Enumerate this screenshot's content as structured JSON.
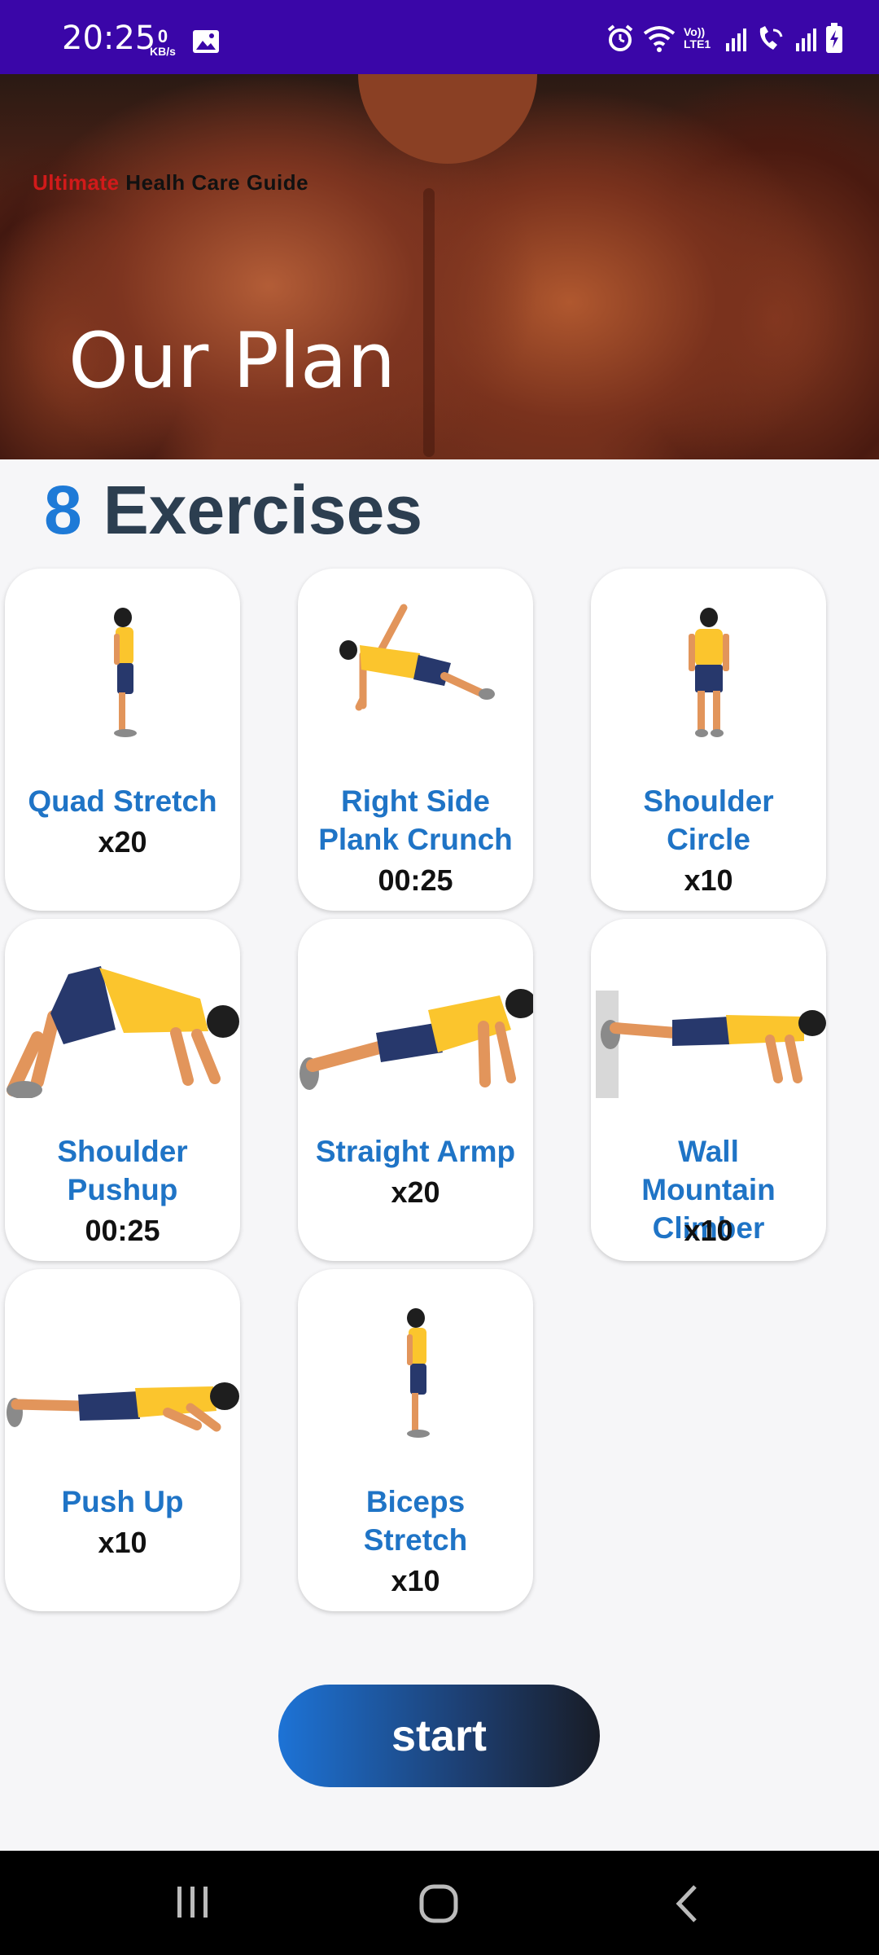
{
  "status_bar": {
    "time": "20:25",
    "network_speed_value": "0",
    "network_speed_unit": "KB/s",
    "volte_label": "Vo)) LTE1"
  },
  "header": {
    "brand_red": "Ultimate",
    "brand_rest": " Healh Care Guide",
    "title": "Our Plan"
  },
  "exercise_summary": {
    "count": "8",
    "label": "Exercises"
  },
  "exercises": [
    {
      "name": "Quad Stretch",
      "reps": "x20",
      "pose": "standing-side"
    },
    {
      "name": "Right Side Plank Crunch",
      "reps": "00:25",
      "pose": "side-plank"
    },
    {
      "name": "Shoulder Circle",
      "reps": "x10",
      "pose": "standing-front"
    },
    {
      "name": "Shoulder Pushup",
      "reps": "00:25",
      "pose": "pike-pushup"
    },
    {
      "name": "Straight Armp",
      "reps": "x20",
      "pose": "plank-high"
    },
    {
      "name": "Wall Mountain Climber",
      "reps": "x10",
      "pose": "wall-plank"
    },
    {
      "name": "Push Up",
      "reps": "x10",
      "pose": "pushup-low"
    },
    {
      "name": "Biceps Stretch",
      "reps": "x10",
      "pose": "standing-side"
    }
  ],
  "start_button": {
    "label": "start"
  },
  "colors": {
    "status_bar": "#3a06a8",
    "accent_blue": "#1f74c6",
    "heading_dark": "#2c3e50"
  }
}
